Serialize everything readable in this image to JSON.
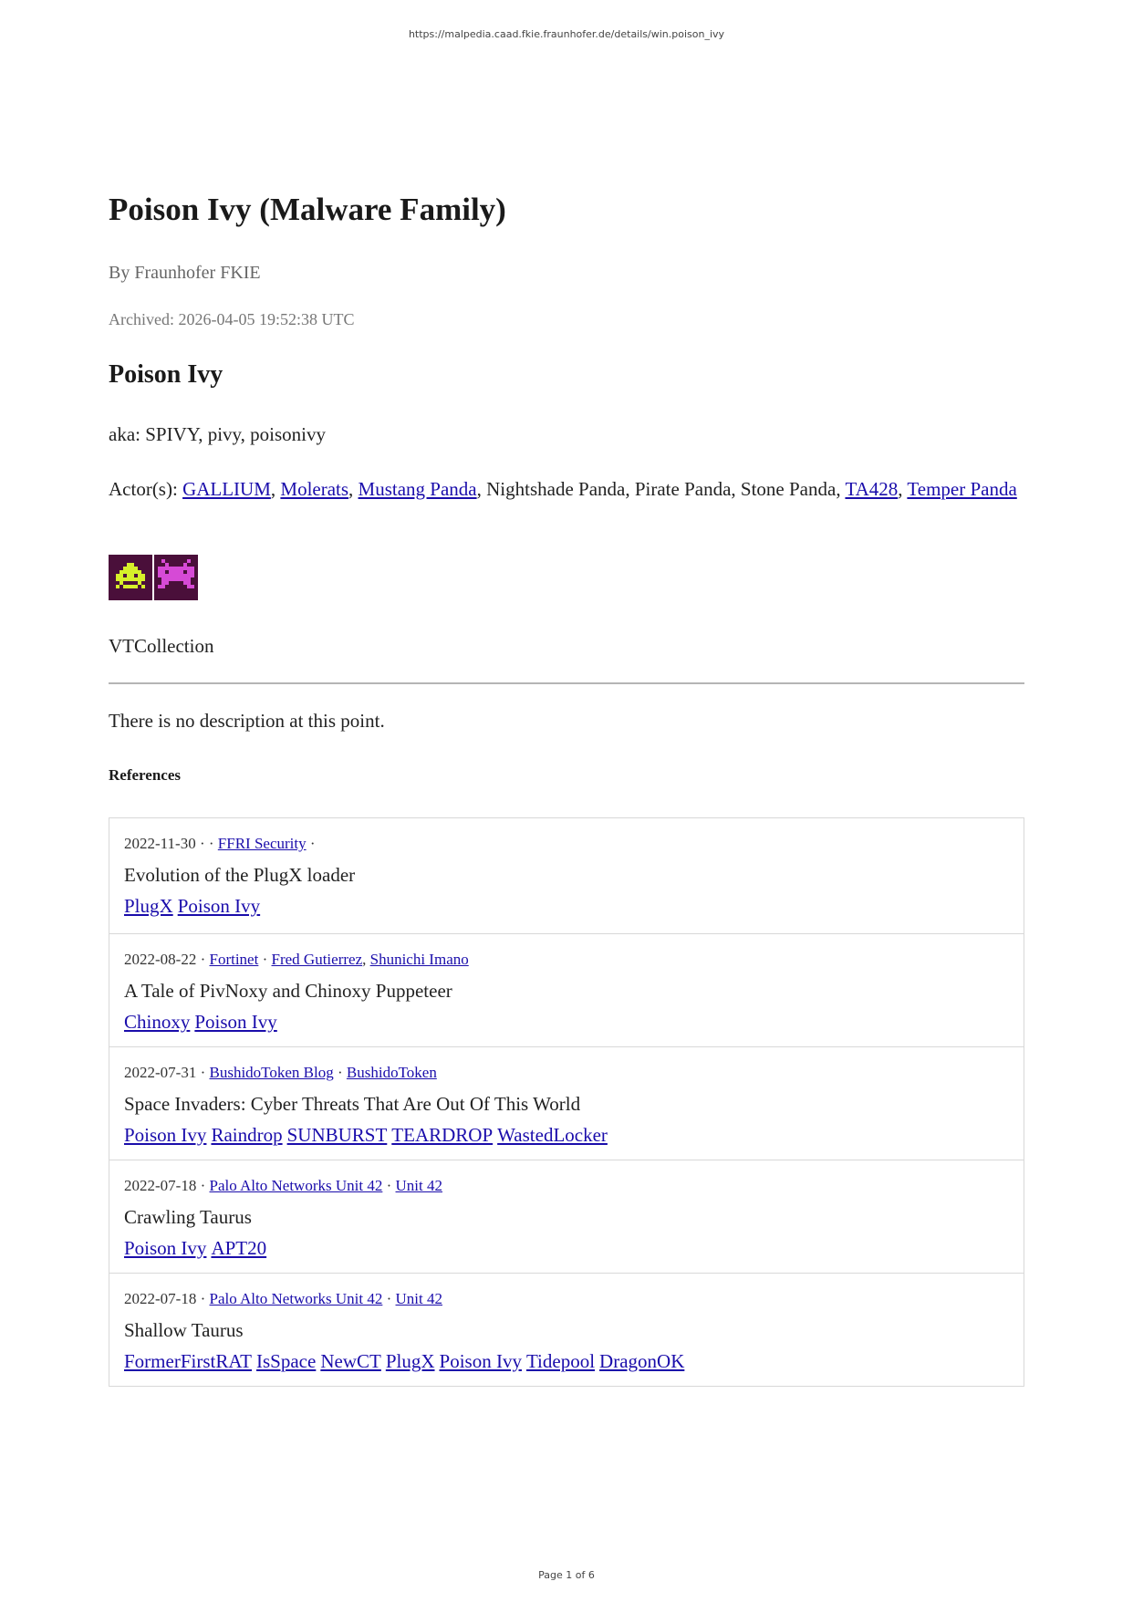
{
  "page": {
    "url": "https://malpedia.caad.fkie.fraunhofer.de/details/win.poison_ivy",
    "footer": "Page 1 of 6"
  },
  "doc": {
    "title": "Poison Ivy (Malware Family)",
    "byline": "By Fraunhofer FKIE",
    "archived": "Archived: 2026-04-05 19:52:38 UTC",
    "subtitle": "Poison Ivy",
    "aka": "aka: SPIVY, pivy, poisonivy",
    "actors_label": "Actor(s):",
    "actors": [
      {
        "name": "GALLIUM",
        "link": true
      },
      {
        "name": "Molerats",
        "link": true
      },
      {
        "name": "Mustang Panda",
        "link": true
      },
      {
        "name": "Nightshade Panda",
        "link": false
      },
      {
        "name": "Pirate Panda",
        "link": false
      },
      {
        "name": "Stone Panda",
        "link": false
      },
      {
        "name": "TA428",
        "link": true
      },
      {
        "name": "Temper Panda",
        "link": true
      }
    ],
    "vtcollection": "VTCollection",
    "description": "There is no description at this point.",
    "references_heading": "References",
    "colors": {
      "link": "#1a0dab",
      "badge_bg": "#4a0f3a",
      "badge_yellow": "#d6f02a",
      "badge_pink": "#d64ad6"
    },
    "badges": [
      "space-invader-yellow-icon",
      "space-invader-pink-icon"
    ]
  },
  "references": [
    {
      "date": "2022-11-30",
      "org": "",
      "authors": [
        "FFRI Security"
      ],
      "trailing_dot": true,
      "title": "Evolution of the PlugX loader",
      "tags": [
        "PlugX",
        "Poison Ivy"
      ]
    },
    {
      "date": "2022-08-22",
      "org": "Fortinet",
      "authors": [
        "Fred Gutierrez",
        "Shunichi Imano"
      ],
      "trailing_dot": false,
      "title": "A Tale of PivNoxy and Chinoxy Puppeteer",
      "tags": [
        "Chinoxy",
        "Poison Ivy"
      ]
    },
    {
      "date": "2022-07-31",
      "org": "BushidoToken Blog",
      "authors": [
        "BushidoToken"
      ],
      "trailing_dot": false,
      "title": "Space Invaders: Cyber Threats That Are Out Of This World",
      "tags": [
        "Poison Ivy",
        "Raindrop",
        "SUNBURST",
        "TEARDROP",
        "WastedLocker"
      ]
    },
    {
      "date": "2022-07-18",
      "org": "Palo Alto Networks Unit 42",
      "authors": [
        "Unit 42"
      ],
      "trailing_dot": false,
      "title": "Crawling Taurus",
      "tags": [
        "Poison Ivy",
        "APT20"
      ]
    },
    {
      "date": "2022-07-18",
      "org": "Palo Alto Networks Unit 42",
      "authors": [
        "Unit 42"
      ],
      "trailing_dot": false,
      "title": "Shallow Taurus",
      "tags": [
        "FormerFirstRAT",
        "IsSpace",
        "NewCT",
        "PlugX",
        "Poison Ivy",
        "Tidepool",
        "DragonOK"
      ]
    }
  ]
}
